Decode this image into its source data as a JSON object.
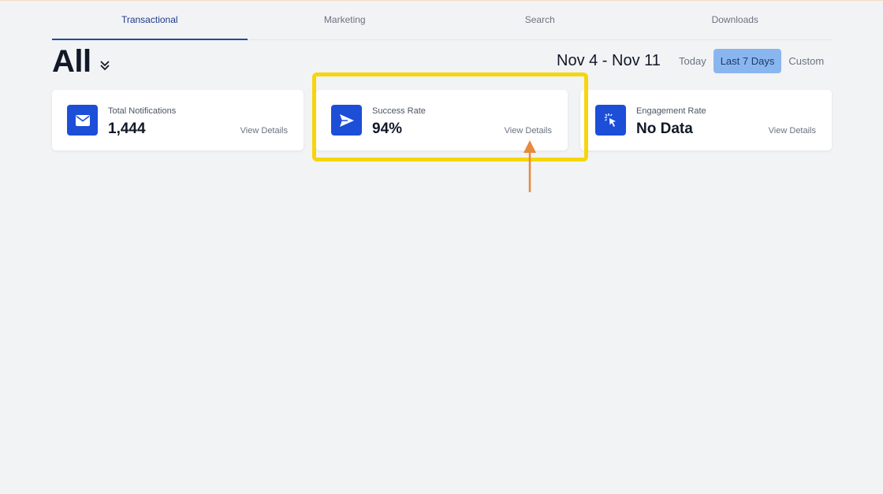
{
  "tabs": [
    {
      "label": "Transactional",
      "active": true
    },
    {
      "label": "Marketing",
      "active": false
    },
    {
      "label": "Search",
      "active": false
    },
    {
      "label": "Downloads",
      "active": false
    }
  ],
  "scope": {
    "label": "All",
    "toggle_icon": "chevrons-down-icon"
  },
  "date_range": "Nov 4 - Nov 11",
  "range_buttons": [
    {
      "label": "Today",
      "active": false
    },
    {
      "label": "Last 7 Days",
      "active": true
    },
    {
      "label": "Custom",
      "active": false
    }
  ],
  "cards": [
    {
      "label": "Total Notifications",
      "value": "1,444",
      "link": "View Details",
      "icon": "envelope-icon"
    },
    {
      "label": "Success Rate",
      "value": "94%",
      "link": "View Details",
      "icon": "send-icon"
    },
    {
      "label": "Engagement Rate",
      "value": "No Data",
      "link": "View Details",
      "icon": "cursor-click-icon"
    }
  ],
  "colors": {
    "accent": "#1d4ed8",
    "highlight": "#f5d60d",
    "arrow": "#e8893a",
    "active_range": "#8ab6f0"
  }
}
